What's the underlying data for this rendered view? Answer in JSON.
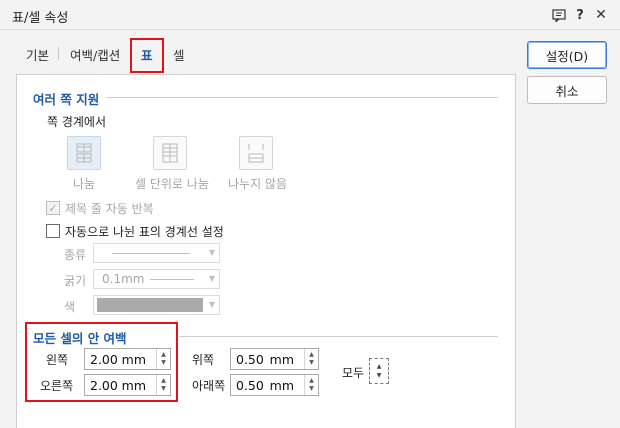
{
  "window": {
    "title": "표/셀 속성"
  },
  "tabs": [
    {
      "label": "기본"
    },
    {
      "label": "여백/캡션"
    },
    {
      "label": "표"
    },
    {
      "label": "셀"
    }
  ],
  "buttons": {
    "ok": "설정(D)",
    "cancel": "취소"
  },
  "split": {
    "section_title": "여러 쪽 지원",
    "boundary_label": "쪽 경계에서",
    "options": [
      {
        "label": "나눔"
      },
      {
        "label": "셀 단위로 나눔"
      },
      {
        "label": "나누지 않음"
      }
    ],
    "repeat_title_label": "제목 줄 자동 반복",
    "auto_border_label": "자동으로 나뉜 표의 경계선 설정",
    "type_label": "종류",
    "width_label": "굵기",
    "width_value": "0.1mm",
    "color_label": "색",
    "swatch_color": "#aaaaaa"
  },
  "margins": {
    "section_title": "모든 셀의 안 여백",
    "left_label": "왼쪽",
    "left_value": "2.00",
    "right_label": "오른쪽",
    "right_value": "2.00",
    "top_label": "위쪽",
    "top_value": "0.50",
    "bottom_label": "아래쪽",
    "bottom_value": "0.50",
    "unit": "mm",
    "all_label": "모두"
  },
  "colors": {
    "accent": "#1f5aa6",
    "highlight": "#e0121b"
  }
}
